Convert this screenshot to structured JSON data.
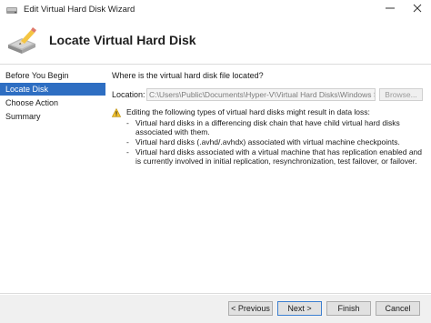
{
  "window": {
    "title": "Edit Virtual Hard Disk Wizard",
    "icons": {
      "app": "disk-icon",
      "minimize": "minimize-icon",
      "close": "close-icon"
    }
  },
  "header": {
    "title": "Locate Virtual Hard Disk",
    "icon": "disk-pencil-icon"
  },
  "sidebar": {
    "items": [
      {
        "label": "Before You Begin",
        "active": false
      },
      {
        "label": "Locate Disk",
        "active": true
      },
      {
        "label": "Choose Action",
        "active": false
      },
      {
        "label": "Summary",
        "active": false
      }
    ]
  },
  "main": {
    "question": "Where is the virtual hard disk file located?",
    "location_label": "Location:",
    "location_value": "C:\\Users\\Public\\Documents\\Hyper-V\\Virtual Hard Disks\\Windows Server.vhdx",
    "browse_label": "Browse...",
    "warning": {
      "icon": "warning-icon",
      "intro": "Editing the following types of virtual hard disks might result in data loss:",
      "items": [
        "Virtual hard disks in a differencing disk chain that have child virtual hard disks associated with them.",
        "Virtual hard disks (.avhd/.avhdx) associated with virtual machine checkpoints.",
        "Virtual hard disks associated with a virtual machine that has replication enabled and is currently involved in initial replication, resynchronization, test failover, or failover."
      ]
    }
  },
  "footer": {
    "previous_label": "< Previous",
    "next_label": "Next >",
    "finish_label": "Finish",
    "cancel_label": "Cancel"
  },
  "colors": {
    "accent": "#2e6ec2",
    "warning": "#f2c12e"
  }
}
